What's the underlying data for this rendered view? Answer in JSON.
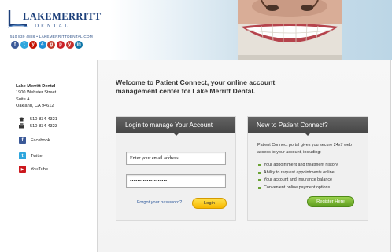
{
  "brand": {
    "name": "LAKEMERRITT",
    "subtitle": "DENTAL",
    "contact": "510 839 4886 • LAKEMERRITTDENTAL.COM",
    "social_icons": [
      {
        "icon": "facebook-icon",
        "glyph": "f",
        "color": "#3b5998"
      },
      {
        "icon": "twitter-icon",
        "glyph": "t",
        "color": "#2fa6dd"
      },
      {
        "icon": "yelp-icon",
        "glyph": "y",
        "color": "#c41200"
      },
      {
        "icon": "foursquare-icon",
        "glyph": "4",
        "color": "#1f8fd6"
      },
      {
        "icon": "google-plus-icon",
        "glyph": "g",
        "color": "#c13a2b"
      },
      {
        "icon": "pinterest-icon",
        "glyph": "p",
        "color": "#cb2027"
      },
      {
        "icon": "yelp-alt-icon",
        "glyph": "y",
        "color": "#c4302b"
      },
      {
        "icon": "linkedin-icon",
        "glyph": "in",
        "color": "#0e76a8"
      }
    ]
  },
  "sidebar": {
    "practice_name": "Lake Merritt Dental",
    "street": "1900 Webster Street",
    "suite": "Suite A",
    "city": "Oakland, CA 94612",
    "phones": [
      "510-834-4321",
      "510-834-4323"
    ],
    "links": [
      {
        "label": "Facebook",
        "icon": "facebook-icon",
        "glyph": "f",
        "color": "#3b5998"
      },
      {
        "label": "Twitter",
        "icon": "twitter-icon",
        "glyph": "t",
        "color": "#2fa6dd"
      },
      {
        "label": "YouTube",
        "icon": "youtube-icon",
        "glyph": "▶",
        "color": "#cc181e"
      }
    ]
  },
  "main": {
    "welcome": "Welcome to Patient Connect, your online account management center for Lake Merritt Dental."
  },
  "login": {
    "heading": "Login to manage Your Account",
    "email_value": "Enter your email address",
    "password_value": "••••••••••••••••••••",
    "forgot_label": "Forgot your password?",
    "login_label": "Login"
  },
  "new_patient": {
    "heading": "New to Patient Connect?",
    "intro": "Patient Connect portal gives you secure 24x7 web access to your account, including:",
    "features": [
      "Your appointment and treatment history",
      "Ability to request appointments online",
      "Your account and insurance balance",
      "Convenient online payment options"
    ],
    "register_label": "Register Here"
  },
  "colors": {
    "accent_green": "#6aa334",
    "login_yellow": "#f7b800",
    "link_blue": "#2f5a9c",
    "panel_header": "#474747"
  }
}
